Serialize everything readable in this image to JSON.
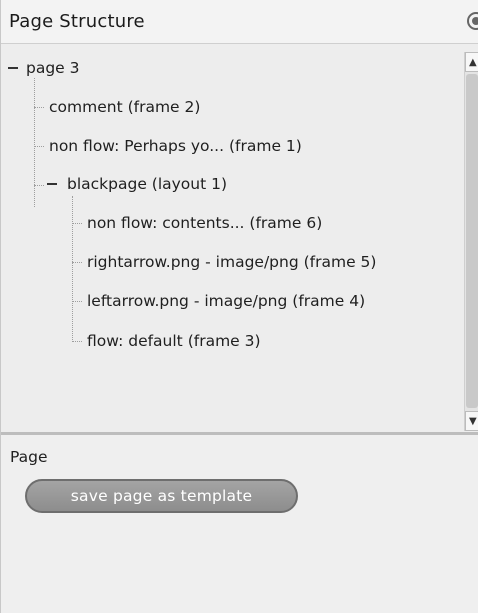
{
  "panel": {
    "title": "Page Structure",
    "close_icon": "circle-close-icon"
  },
  "tree": {
    "items": [
      {
        "label": "page 3",
        "expanded": true,
        "level": 0
      },
      {
        "label": "comment (frame 2)",
        "level": 1
      },
      {
        "label": "non flow: Perhaps yo... (frame 1)",
        "level": 1
      },
      {
        "label": "blackpage (layout 1)",
        "expanded": true,
        "level": 1
      },
      {
        "label": "non flow: contents... (frame 6)",
        "level": 2
      },
      {
        "label": "rightarrow.png - image/png (frame 5)",
        "level": 2
      },
      {
        "label": "leftarrow.png - image/png (frame 4)",
        "level": 2
      },
      {
        "label": "flow: default (frame 3)",
        "level": 2
      }
    ]
  },
  "scrollbar": {
    "up_icon": "scroll-up-arrow-icon",
    "down_icon": "scroll-down-arrow-icon"
  },
  "page_section": {
    "title": "Page",
    "button_label": "save page as template"
  }
}
